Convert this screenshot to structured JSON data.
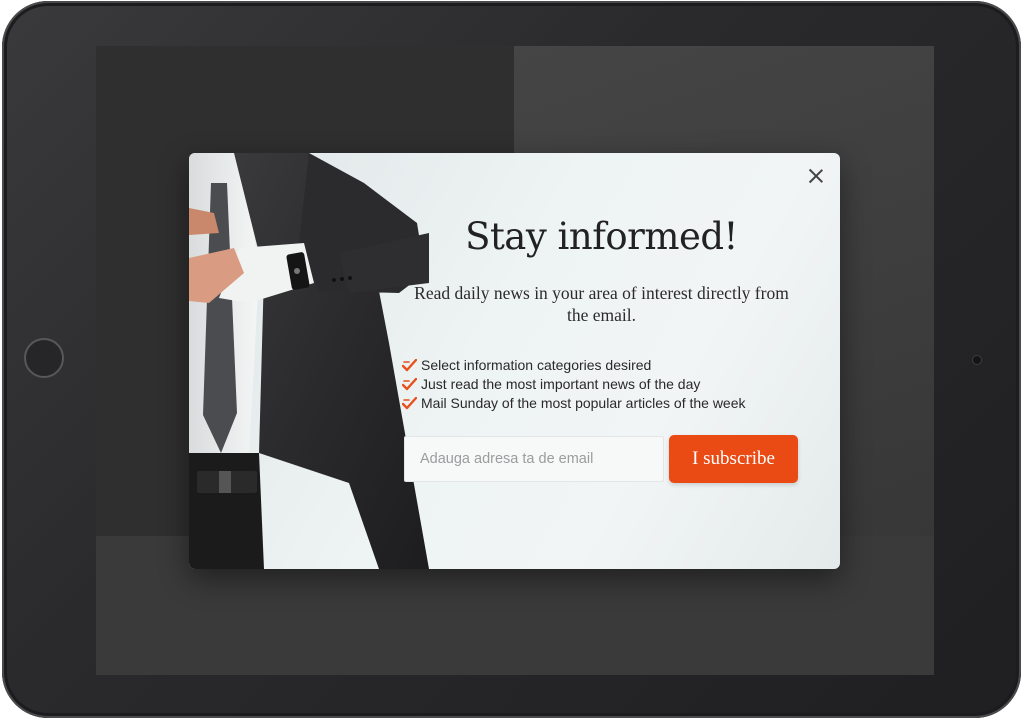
{
  "device": {
    "home_button_icon": "home-button-icon",
    "camera_icon": "camera-icon"
  },
  "background_page": {
    "nav_text": "",
    "caption": ""
  },
  "modal": {
    "close_icon": "close-icon",
    "title": "Stay informed!",
    "subtitle": "Read daily news in your area of interest directly from the email.",
    "features": [
      {
        "icon": "check-icon",
        "text": "Select information categories desired"
      },
      {
        "icon": "check-icon",
        "text": "Just read the most important news of the day"
      },
      {
        "icon": "check-icon",
        "text": "Mail Sunday of the most popular articles of the week"
      }
    ],
    "email_input": {
      "value": "",
      "placeholder": "Adauga adresa ta de email"
    },
    "subscribe_label": "I subscribe",
    "colors": {
      "accent": "#ea4a14",
      "check": "#e8501c"
    }
  }
}
